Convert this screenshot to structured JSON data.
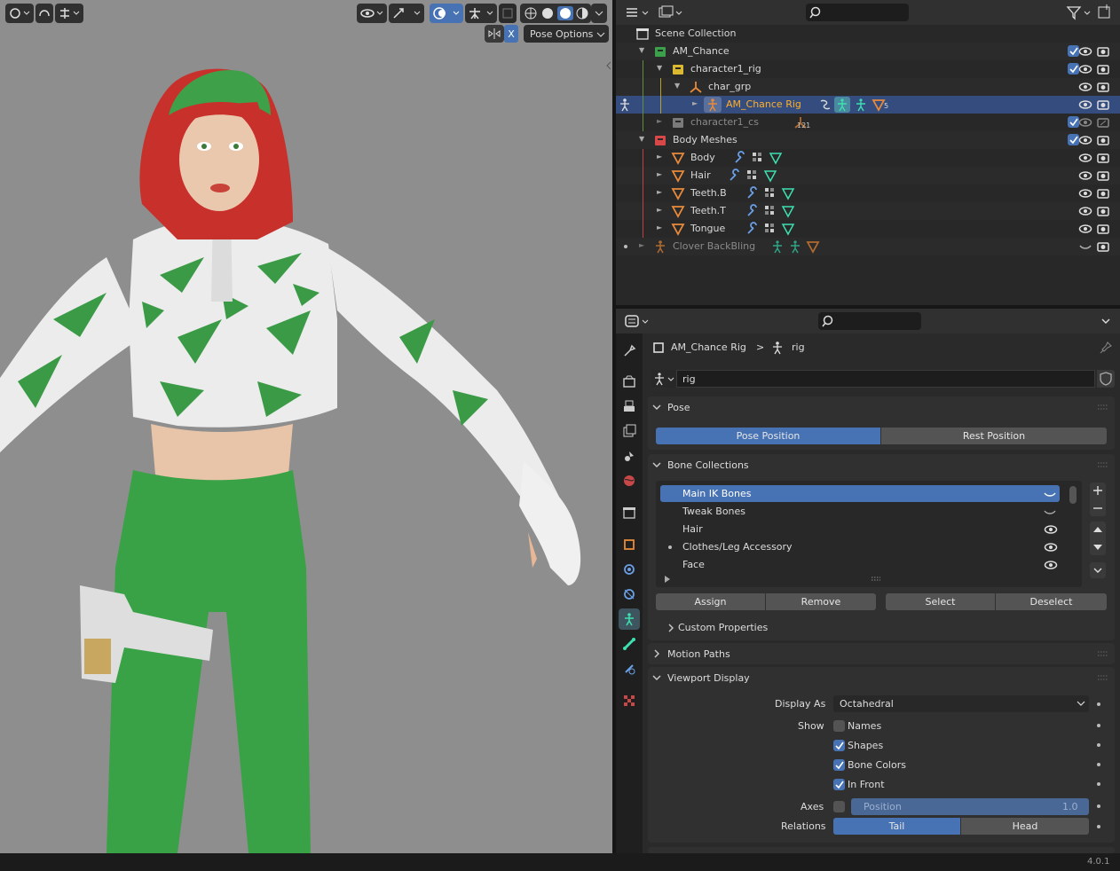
{
  "viewport": {
    "pose_options_label": "Pose Options",
    "x_toggle": "X"
  },
  "outliner": {
    "rows": [
      {
        "label": "Scene Collection"
      },
      {
        "label": "AM_Chance"
      },
      {
        "label": "character1_rig"
      },
      {
        "label": "char_grp"
      },
      {
        "label": "AM_Chance Rig",
        "badge": "5"
      },
      {
        "label": "character1_cs",
        "badge": "121"
      },
      {
        "label": "Body Meshes"
      },
      {
        "label": "Body"
      },
      {
        "label": "Hair"
      },
      {
        "label": "Teeth.B"
      },
      {
        "label": "Teeth.T"
      },
      {
        "label": "Tongue"
      },
      {
        "label": "Clover BackBling"
      }
    ]
  },
  "properties": {
    "breadcrumb": {
      "object": "AM_Chance Rig",
      "separator": ">",
      "data": "rig"
    },
    "datablock_name": "rig",
    "pose_panel": {
      "title": "Pose",
      "pose_position": "Pose Position",
      "rest_position": "Rest Position"
    },
    "bone_collections": {
      "title": "Bone Collections",
      "items": [
        "Main IK Bones",
        "Tweak Bones",
        "Hair",
        "Clothes/Leg Accessory",
        "Face"
      ],
      "assign": "Assign",
      "remove": "Remove",
      "select": "Select",
      "deselect": "Deselect",
      "custom_properties": "Custom Properties"
    },
    "motion_paths": {
      "title": "Motion Paths"
    },
    "viewport_display": {
      "title": "Viewport Display",
      "display_as_label": "Display As",
      "display_as_value": "Octahedral",
      "show_label": "Show",
      "names": "Names",
      "shapes": "Shapes",
      "bone_colors": "Bone Colors",
      "in_front": "In Front",
      "axes_label": "Axes",
      "axes_position_label": "Position",
      "axes_position_value": "1.0",
      "relations_label": "Relations",
      "tail": "Tail",
      "head": "Head"
    }
  },
  "status": {
    "version": "4.0.1"
  },
  "colors": {
    "accent": "#4772b3",
    "selected_row": "#344d7e",
    "active_object_text": "#ffaf29",
    "jacket_green": "#3a9a45",
    "hair_red": "#c8302c"
  }
}
